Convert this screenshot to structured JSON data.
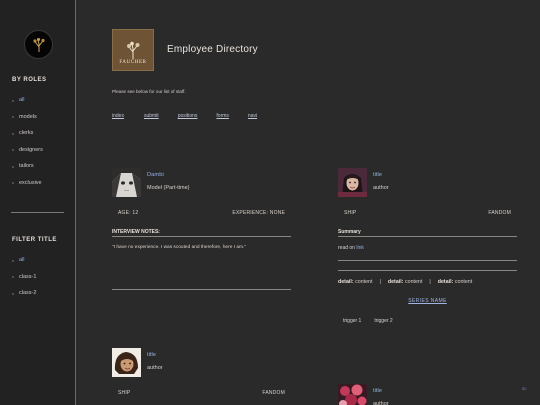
{
  "sidebar": {
    "roles_heading": "BY ROLES",
    "roles": [
      "all",
      "models",
      "clerks",
      "designers",
      "tailors",
      "exclusive"
    ],
    "filter_heading": "FILTER TITLE",
    "filters": [
      "all",
      "class-1",
      "class-2"
    ]
  },
  "header": {
    "logo_text": "FAUCHER",
    "title": "Employee Directory",
    "intro": "Please see below for our list of staff.",
    "nav": [
      "index",
      "submit",
      "positions",
      "forms",
      "navi"
    ]
  },
  "cards": [
    {
      "name": "Dambi",
      "role": "Model (Part-time)",
      "stat_left": "AGE: 12",
      "stat_right": "EXPERIENCE: NONE",
      "section_heading": "INTERVIEW NOTES:",
      "quote": "\"I have no experience. I was scouted and therefore, here I am.\""
    },
    {
      "name": "title",
      "role": "author",
      "stat_left": "SHIP",
      "stat_right": "FANDOM",
      "section_heading": "Summary",
      "readon_prefix": "read on",
      "readon_link": "link",
      "detail_label": "detail:",
      "detail_value": "content",
      "detail_sep": "|",
      "series": "SERIES NAME",
      "triggers": [
        "trigger 1",
        "trigger 2"
      ]
    },
    {
      "name": "title",
      "role": "author",
      "stat_left": "SHIP",
      "stat_right": "FANDOM"
    },
    {
      "name": "title",
      "role": "author"
    }
  ],
  "corner_label": "sc",
  "colors": {
    "accent": "#8fb0e0",
    "background": "#2b2a2a",
    "sidebar": "#232222"
  }
}
